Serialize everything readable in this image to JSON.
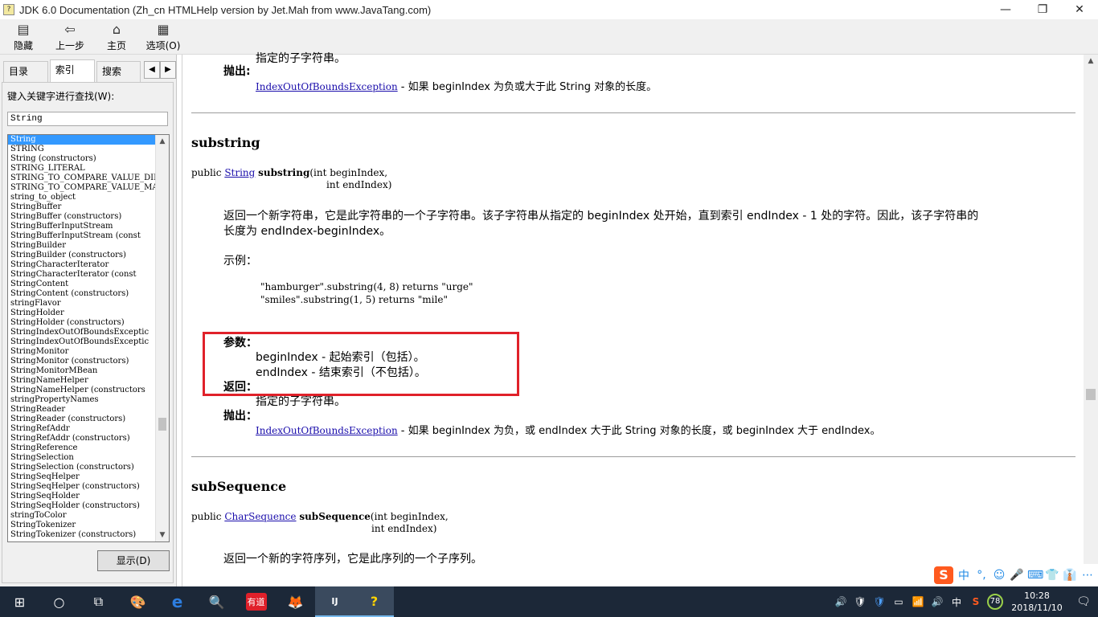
{
  "window": {
    "title": "JDK 6.0 Documentation (Zh_cn HTMLHelp version by Jet.Mah from www.JavaTang.com)",
    "minimize": "—",
    "restore": "❐",
    "close": "✕"
  },
  "toolbar": {
    "hide": "隐藏",
    "back": "上一步",
    "home": "主页",
    "options": "选项(O)"
  },
  "left": {
    "tabs": [
      "目录(C)",
      "索引(N)",
      "搜索(S)"
    ],
    "search_label": "键入关键字进行查找(W):",
    "search_value": "String",
    "display_button": "显示(D)",
    "index_items": [
      "String",
      "STRING",
      "String (constructors)",
      "STRING_LITERAL",
      "STRING_TO_COMPARE_VALUE_DIFFER",
      "STRING_TO_COMPARE_VALUE_MATCHE",
      "string_to_object",
      "StringBuffer",
      "StringBuffer (constructors)",
      "StringBufferInputStream",
      "StringBufferInputStream (const",
      "StringBuilder",
      "StringBuilder (constructors)",
      "StringCharacterIterator",
      "StringCharacterIterator (const",
      "StringContent",
      "StringContent (constructors)",
      "stringFlavor",
      "StringHolder",
      "StringHolder (constructors)",
      "StringIndexOutOfBoundsExceptic",
      "StringIndexOutOfBoundsExceptic",
      "StringMonitor",
      "StringMonitor (constructors)",
      "StringMonitorMBean",
      "StringNameHelper",
      "StringNameHelper (constructors",
      "stringPropertyNames",
      "StringReader",
      "StringReader (constructors)",
      "StringRefAddr",
      "StringRefAddr (constructors)",
      "StringReference",
      "StringSelection",
      "StringSelection (constructors)",
      "StringSeqHelper",
      "StringSeqHelper (constructors)",
      "StringSeqHolder",
      "StringSeqHolder (constructors)",
      "stringToColor",
      "StringTokenizer",
      "StringTokenizer (constructors)"
    ]
  },
  "content": {
    "top_partial": "指定的子字符串。",
    "throws_label": "抛出:",
    "exc1_link": "IndexOutOfBoundsException",
    "exc1_desc": " - 如果 beginIndex 为负或大于此 String 对象的长度。",
    "substring": {
      "heading": "substring",
      "sig_prefix": "public ",
      "sig_type": "String",
      "sig_name": "substring",
      "sig_params1": "(int beginIndex,",
      "sig_params2": "int endIndex)",
      "desc1": "返回一个新字符串，它是此字符串的一个子字符串。该子字符串从指定的 beginIndex 处开始，直到索引 endIndex - 1 处的字符。因此，该子字符串的",
      "desc2": "长度为 endIndex-beginIndex。",
      "example_label": "示例：",
      "example1": "\"hamburger\".substring(4, 8) returns \"urge\"",
      "example2": "\"smiles\".substring(1, 5) returns \"mile\"",
      "params_label": "参数：",
      "param1": "beginIndex - 起始索引（包括）。",
      "param2": "endIndex - 结束索引（不包括）。",
      "returns_label": "返回：",
      "returns_text": "指定的子字符串。",
      "throws_label": "抛出：",
      "exc_link": "IndexOutOfBoundsException",
      "exc_desc": " - 如果 beginIndex 为负，或 endIndex 大于此 String 对象的长度，或 beginIndex 大于 endIndex。"
    },
    "subsequence": {
      "heading": "subSequence",
      "sig_prefix": "public ",
      "sig_type": "CharSequence",
      "sig_name": "subSequence",
      "sig_params1": "(int beginIndex,",
      "sig_params2": "int endIndex)",
      "desc1": "返回一个新的字符序列，它是此序列的一个子序列。"
    }
  },
  "ime": {
    "logo": "S",
    "lang": "中",
    "icons": [
      "°,",
      "☺",
      "🎤",
      "⌨",
      "👕",
      "👔",
      "⋯"
    ]
  },
  "taskbar": {
    "apps": [
      "⊞",
      "○",
      "⧉",
      "🎨",
      "e",
      "🔍",
      "有道",
      "🦊",
      "IJ",
      "?"
    ],
    "tray": [
      "🔊",
      "🛡",
      "🛡",
      "▭",
      "📶",
      "🔊",
      "中",
      "S",
      "78"
    ],
    "time": "10:28",
    "date": "2018/11/10",
    "notify": "🗨"
  }
}
